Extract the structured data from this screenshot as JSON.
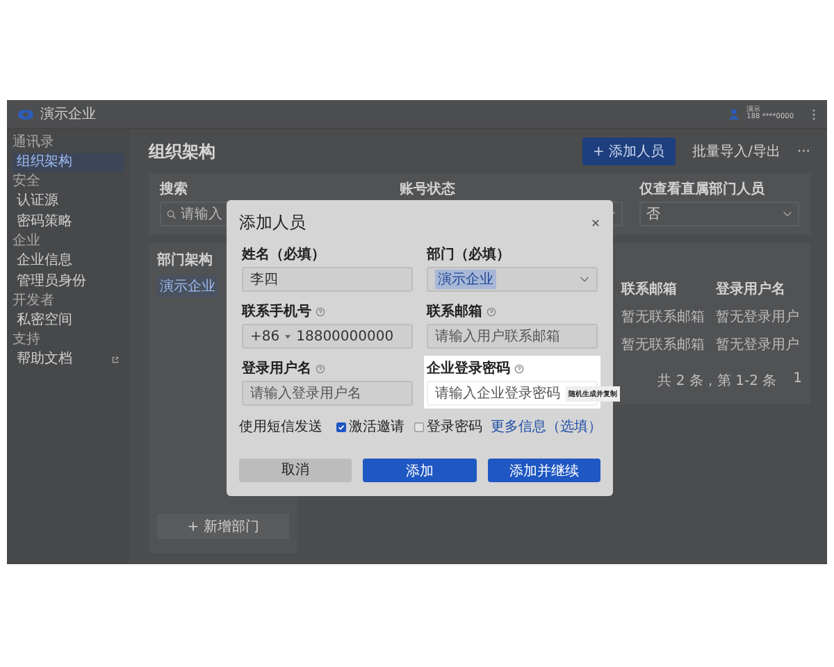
{
  "topbar": {
    "org_name": "演示企业",
    "user_name": "演示",
    "user_phone": "188 ****0000"
  },
  "sidebar": {
    "sections": [
      {
        "label": "通讯录",
        "items": [
          {
            "label": "组织架构",
            "selected": true,
            "external": false
          }
        ]
      },
      {
        "label": "安全",
        "items": [
          {
            "label": "认证源",
            "selected": false,
            "external": false
          },
          {
            "label": "密码策略",
            "selected": false,
            "external": false
          }
        ]
      },
      {
        "label": "企业",
        "items": [
          {
            "label": "企业信息",
            "selected": false,
            "external": false
          },
          {
            "label": "管理员身份",
            "selected": false,
            "external": false
          }
        ]
      },
      {
        "label": "开发者",
        "items": [
          {
            "label": "私密空间",
            "selected": false,
            "external": false
          }
        ]
      },
      {
        "label": "支持",
        "items": [
          {
            "label": "帮助文档",
            "selected": false,
            "external": true
          }
        ]
      }
    ]
  },
  "page": {
    "title": "组织架构",
    "add_button": "+ 添加人员",
    "import_button": "批量导入/导出",
    "more_button": "···"
  },
  "filters": [
    {
      "label": "搜索",
      "kind": "search",
      "placeholder": "请输入"
    },
    {
      "label": "账号状态",
      "kind": "select"
    },
    {
      "label": "仅查看直属部门人员",
      "kind": "select",
      "value": "否"
    }
  ],
  "departments": {
    "title": "部门架构",
    "items": [
      {
        "label": "演示企业",
        "selected": true
      }
    ],
    "add_button": "+ 新增部门"
  },
  "table": {
    "columns": [
      "联系邮箱",
      "登录用户名"
    ],
    "rows": [
      [
        "暂无联系邮箱",
        "暂无登录用户"
      ],
      [
        "暂无联系邮箱",
        "暂无登录用户"
      ]
    ],
    "summary": "共 2 条，第 1-2 条",
    "page": "1"
  },
  "dialog": {
    "title": "添加人员",
    "fields": [
      {
        "label": "姓名（必填）",
        "kind": "text",
        "value": "李四",
        "help": false,
        "highlighted": false
      },
      {
        "label": "部门（必填）",
        "kind": "select",
        "tag": "演示企业",
        "help": false,
        "highlighted": false
      },
      {
        "label": "联系手机号",
        "kind": "phone",
        "prefix": "+86",
        "value": "18800000000",
        "help": true,
        "highlighted": false
      },
      {
        "label": "联系邮箱",
        "kind": "text",
        "placeholder": "请输入用户联系邮箱",
        "help": true,
        "highlighted": false
      },
      {
        "label": "登录用户名",
        "kind": "text",
        "placeholder": "请输入登录用户名",
        "help": true,
        "highlighted": false
      },
      {
        "label": "企业登录密码",
        "kind": "password",
        "placeholder": "请输入企业登录密码",
        "action": "随机生成并复制",
        "help": true,
        "highlighted": true
      }
    ],
    "sms_label": "使用短信发送",
    "options": [
      {
        "label": "激活邀请",
        "checked": true
      },
      {
        "label": "登录密码",
        "checked": false
      }
    ],
    "more_link": "更多信息（选填）",
    "buttons": [
      {
        "label": "取消",
        "kind": "secondary"
      },
      {
        "label": "添加",
        "kind": "primary"
      },
      {
        "label": "添加并继续",
        "kind": "primary"
      }
    ]
  }
}
